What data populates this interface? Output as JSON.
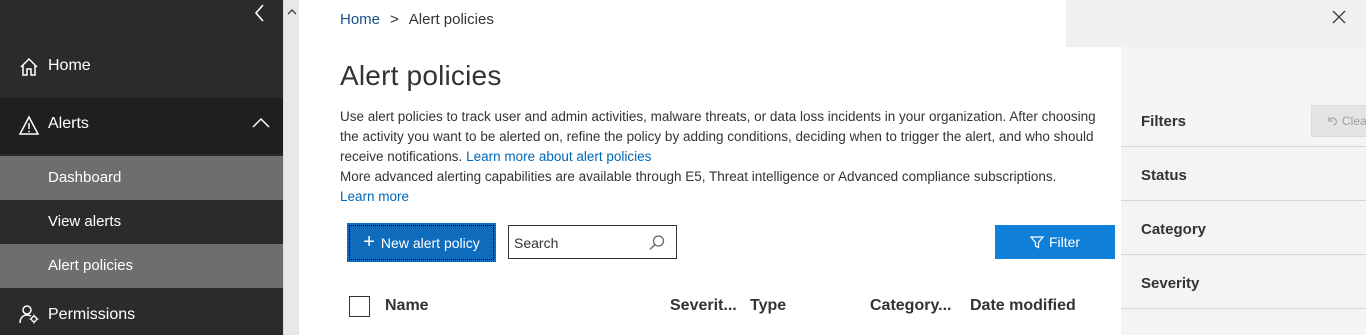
{
  "nav": {
    "home": "Home",
    "alerts": "Alerts",
    "sub_items": [
      "Dashboard",
      "View alerts",
      "Alert policies"
    ],
    "permissions": "Permissions"
  },
  "breadcrumb": {
    "home": "Home",
    "separator": ">",
    "current": "Alert policies"
  },
  "page": {
    "title": "Alert policies",
    "description_line1": "Use alert policies to track user and admin activities, malware threats, or data loss incidents in your organization. After choosing the activity you want to be alerted on, refine the policy by adding conditions, deciding when to trigger the alert, and who should receive notifications.",
    "learn_more_policies": "Learn more about alert policies",
    "description_line2": "More advanced alerting capabilities are available through E5, Threat intelligence or Advanced compliance subscriptions.",
    "learn_more": "Learn more"
  },
  "toolbar": {
    "new_policy_label": "New alert policy",
    "search_placeholder": "Search",
    "filter_label": "Filter"
  },
  "table": {
    "columns": [
      "Name",
      "Severit...",
      "Type",
      "Category...",
      "Date modified"
    ]
  },
  "filters_panel": {
    "title": "Filters",
    "clear_label": "Clea",
    "sections": [
      "Status",
      "Category",
      "Severity"
    ]
  },
  "colors": {
    "nav_bg": "#2b2b2b",
    "nav_selected": "#6e6e6e",
    "primary": "#0f6cbd",
    "link": "#0067b8"
  }
}
